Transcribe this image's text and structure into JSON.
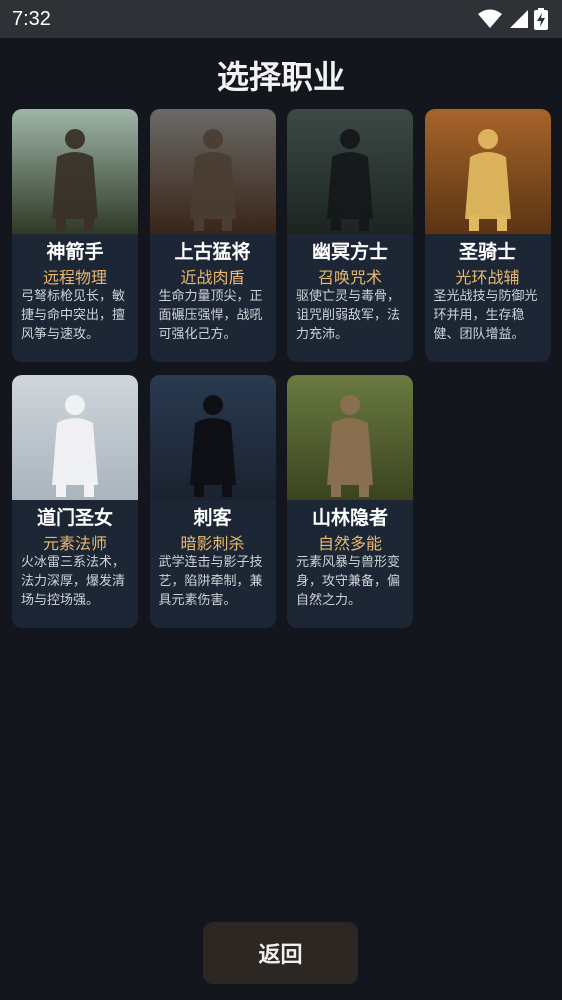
{
  "status_bar": {
    "time": "7:32",
    "icons": [
      "wifi-icon",
      "cellular-signal-icon",
      "battery-charging-icon"
    ]
  },
  "title": "选择职业",
  "classes": [
    {
      "name": "神箭手",
      "role": "远程物理",
      "desc": "弓弩标枪见长，敏捷与命中突出，擅风筝与速攻。",
      "image": "archer-portrait",
      "colors": {
        "top": "#9fb5a8",
        "bottom": "#2f3a26",
        "figure": "#3a3228"
      }
    },
    {
      "name": "上古猛将",
      "role": "近战肉盾",
      "desc": "生命力量顶尖，正面碾压强悍，战吼可强化己方。",
      "image": "warrior-portrait",
      "colors": {
        "top": "#6a6a66",
        "bottom": "#3a2418",
        "figure": "#4a3e32"
      }
    },
    {
      "name": "幽冥方士",
      "role": "召唤咒术",
      "desc": "驱使亡灵与毒骨，诅咒削弱敌军，法力充沛。",
      "image": "necromancer-portrait",
      "colors": {
        "top": "#3c4a46",
        "bottom": "#1c2420",
        "figure": "#15181a"
      }
    },
    {
      "name": "圣骑士",
      "role": "光环战辅",
      "desc": "圣光战技与防御光环并用，生存稳健、团队增益。",
      "image": "paladin-portrait",
      "colors": {
        "top": "#a8642a",
        "bottom": "#5a3414",
        "figure": "#e0b860"
      }
    },
    {
      "name": "道门圣女",
      "role": "元素法师",
      "desc": "火冰雷三系法术，法力深厚，爆发清场与控场强。",
      "image": "priestess-portrait",
      "colors": {
        "top": "#cfd6dc",
        "bottom": "#aab4bc",
        "figure": "#f2f2f4"
      }
    },
    {
      "name": "刺客",
      "role": "暗影刺杀",
      "desc": "武学连击与影子技艺，陷阱牵制，兼具元素伤害。",
      "image": "assassin-portrait",
      "colors": {
        "top": "#2a3a50",
        "bottom": "#1a2230",
        "figure": "#0e0f14"
      }
    },
    {
      "name": "山林隐者",
      "role": "自然多能",
      "desc": "元素风暴与兽形变身，攻守兼备，偏自然之力。",
      "image": "hermit-portrait",
      "colors": {
        "top": "#6a7a40",
        "bottom": "#3a4420",
        "figure": "#8a7050"
      }
    }
  ],
  "back_label": "返回"
}
